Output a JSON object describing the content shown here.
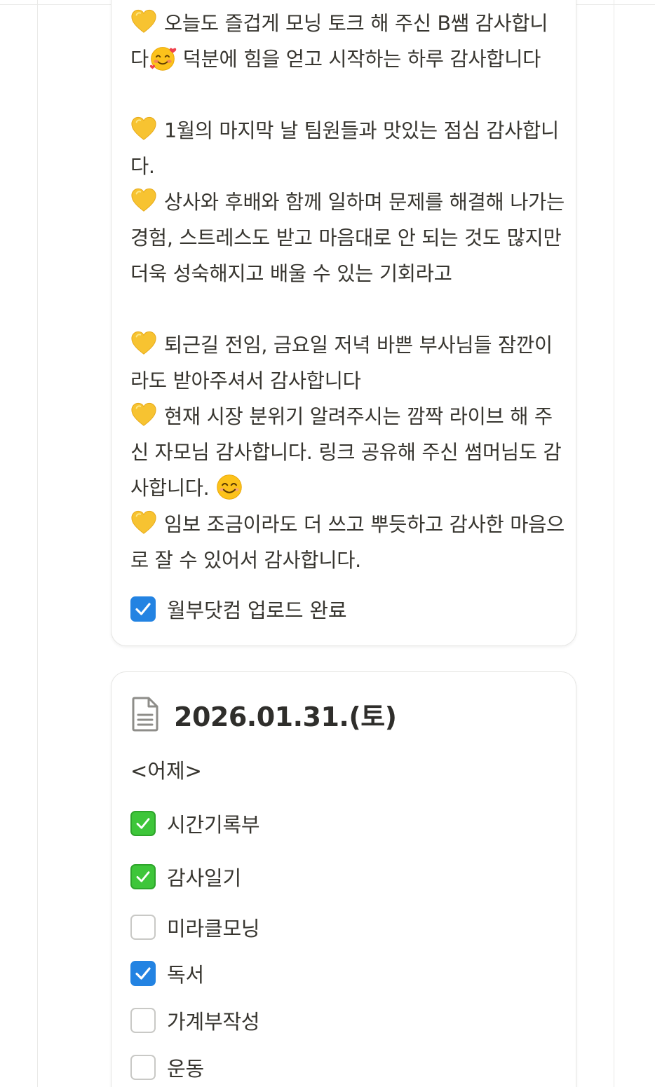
{
  "card1": {
    "gratitude_lines": [
      {
        "id": "g1",
        "icon": "yellow-heart-icon",
        "text": "오늘도 즐겁게 모닝 토크 해 주신 B쌤 감사합니다",
        "emoji": "smiling-face-with-hearts-icon",
        "tail": " 덕분에 힘을 얻고 시작하는 하루 감사합니다"
      },
      {
        "id": "g2",
        "icon": "yellow-heart-icon",
        "text": "1월의 마지막 날 팀원들과 맛있는 점심 감사합니다."
      },
      {
        "id": "g3",
        "icon": "yellow-heart-icon",
        "text": "상사와 후배와 함께 일하며 문제를 해결해 나가는 경험, 스트레스도 받고 마음대로 안 되는 것도 많지만 더욱 성숙해지고 배울 수 있는 기회라고"
      },
      {
        "id": "g4",
        "icon": "yellow-heart-icon",
        "text": "퇴근길 전임, 금요일 저녁 바쁜 부사님들 잠깐이라도 받아주셔서 감사합니다"
      },
      {
        "id": "g5",
        "icon": "yellow-heart-icon",
        "text": "현재 시장 분위기 알려주시는 깜짝 라이브 해 주신 자모님 감사합니다. 링크 공유해 주신 썸머님도 감사합니다. ",
        "emoji": "smiling-face-icon"
      },
      {
        "id": "g6",
        "icon": "yellow-heart-icon",
        "text": "임보 조금이라도 더 쓰고 뿌듯하고 감사한 마음으로 잘 수 있어서 감사합니다."
      }
    ],
    "todo": {
      "label": "월부닷컴 업로드 완료",
      "checked": true
    }
  },
  "card2": {
    "icon": "document-icon",
    "title": "2026.01.31.(토)",
    "section_label": "<어제>",
    "todos": [
      {
        "label": "시간기록부",
        "state": "green-check",
        "icon": "check-mark-button-icon"
      },
      {
        "label": "감사일기",
        "state": "green-check",
        "icon": "check-mark-button-icon"
      },
      {
        "label": "미라클모닝",
        "state": "unchecked"
      },
      {
        "label": "독서",
        "state": "checked"
      },
      {
        "label": "가계부작성",
        "state": "unchecked"
      },
      {
        "label": "운동",
        "state": "unchecked"
      }
    ]
  },
  "colors": {
    "checkbox_blue": "#2383e2",
    "emoji_green": "#3ec63a",
    "heart_yellow": "#f7c331",
    "text": "#37352f"
  }
}
